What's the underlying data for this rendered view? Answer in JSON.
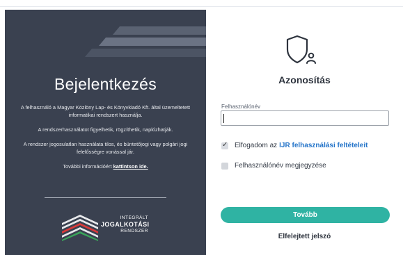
{
  "left_panel": {
    "title": "Bejelentkezés",
    "paragraph1": "A felhasználó a Magyar Közlöny Lap- és Könyvkiadó Kft. által üzemeltetett informatikai rendszert használja.",
    "paragraph2": "A rendszerhasználatot figyelhetik, rögzíthetik, naplózhatják.",
    "paragraph3": "A rendszer jogosulatlan használata tilos, és büntetőjogi vagy polgári jogi felelősségre vonással jár.",
    "info_prefix": "További információért ",
    "info_link": "kattintson ide.",
    "logo": {
      "line1": "INTEGRÁLT",
      "line2": "JOGALKOTÁSI",
      "line3": "RENDSZER"
    }
  },
  "right_panel": {
    "icon": "shield-user-icon",
    "title": "Azonosítás",
    "username_label": "Felhasználónév",
    "username_value": "",
    "accept_checked": true,
    "accept_prefix": "Elfogadom az",
    "accept_link": "IJR felhasználási feltételeit",
    "remember_checked": false,
    "remember_label": "Felhasználónév megjegyzése",
    "submit_label": "Tovább",
    "forgot_label": "Elfelejtett jelszó"
  },
  "colors": {
    "left_panel_bg": "#3a4150",
    "accent_teal": "#2fb3a3",
    "link_blue": "#2474c9"
  }
}
